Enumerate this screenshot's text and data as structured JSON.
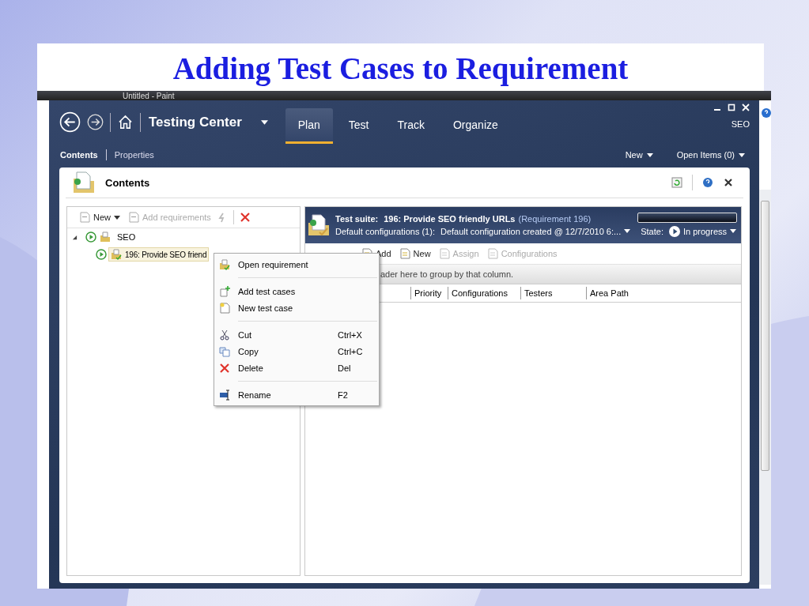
{
  "slide_title": "Adding Test Cases to Requirement",
  "background_window": {
    "title": "Untitled - Paint"
  },
  "app": {
    "title": "Testing Center",
    "user": "SEO",
    "nav_tabs": [
      {
        "label": "Plan",
        "selected": true
      },
      {
        "label": "Test",
        "selected": false
      },
      {
        "label": "Track",
        "selected": false
      },
      {
        "label": "Organize",
        "selected": false
      }
    ],
    "sub_tabs": [
      {
        "label": "Contents",
        "selected": true
      },
      {
        "label": "Properties",
        "selected": false
      }
    ],
    "menus": [
      "New",
      "Open Items (0)"
    ]
  },
  "panel": {
    "title": "Contents"
  },
  "tree_toolbar": [
    {
      "label": "New",
      "kind": "dropdown",
      "disabled": false
    },
    {
      "label": "Add requirements",
      "kind": "button",
      "disabled": true
    }
  ],
  "tree": [
    {
      "label": "SEO",
      "expanded": true,
      "selected": false,
      "children": [
        {
          "label": "196: Provide SEO friend",
          "selected": true
        }
      ]
    }
  ],
  "suite": {
    "label": "Test suite:",
    "name": "196: Provide SEO friendly URLs",
    "requirement": "(Requirement 196)",
    "config_label": "Default configurations (1):",
    "config_value": "Default configuration created @ 12/7/2010 6:...",
    "state_label": "State:",
    "state": "In progress",
    "progress": {
      "level": 0
    }
  },
  "suite_toolbar": [
    {
      "label": "Add",
      "disabled": false
    },
    {
      "label": "New",
      "disabled": false
    },
    {
      "label": "Assign",
      "disabled": true
    },
    {
      "label": "Configurations",
      "disabled": true
    }
  ],
  "group_hint": "ader here to group by that column.",
  "columns": [
    "Priority",
    "Configurations",
    "Testers",
    "Area Path"
  ],
  "context_menu": [
    [
      {
        "label": "Open requirement",
        "kind": "requirement"
      }
    ],
    [
      {
        "label": "Add test cases",
        "kind": "add"
      },
      {
        "label": "New test case",
        "kind": "new"
      }
    ],
    [
      {
        "label": "Cut",
        "shortcut": "Ctrl+X",
        "kind": "cut"
      },
      {
        "label": "Copy",
        "shortcut": "Ctrl+C",
        "kind": "copy"
      },
      {
        "label": "Delete",
        "shortcut": "Del",
        "kind": "delete"
      }
    ],
    [
      {
        "label": "Rename",
        "shortcut": "F2",
        "kind": "rename"
      }
    ]
  ]
}
